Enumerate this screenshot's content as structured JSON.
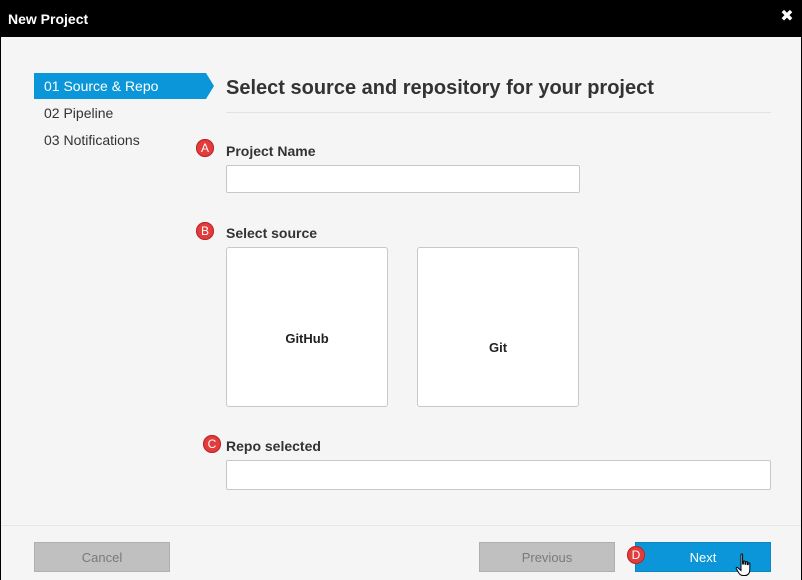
{
  "window": {
    "title": "New Project",
    "close_glyph": "✖"
  },
  "nav": {
    "items": [
      {
        "label": "01 Source & Repo",
        "active": true
      },
      {
        "label": "02 Pipeline",
        "active": false
      },
      {
        "label": "03 Notifications",
        "active": false
      }
    ]
  },
  "main": {
    "title": "Select source and repository for your project",
    "markers": [
      "A",
      "B",
      "C",
      "D"
    ],
    "project_name": {
      "label": "Project Name",
      "value": ""
    },
    "source": {
      "label": "Select source",
      "options": [
        "GitHub",
        "Git"
      ]
    },
    "repo": {
      "label": "Repo selected",
      "value": ""
    }
  },
  "footer": {
    "cancel_label": "Cancel",
    "previous_label": "Previous",
    "next_label": "Next"
  },
  "colors": {
    "accent": "#0a96d8",
    "marker": "#e23c3c",
    "titlebar": "#000000"
  }
}
